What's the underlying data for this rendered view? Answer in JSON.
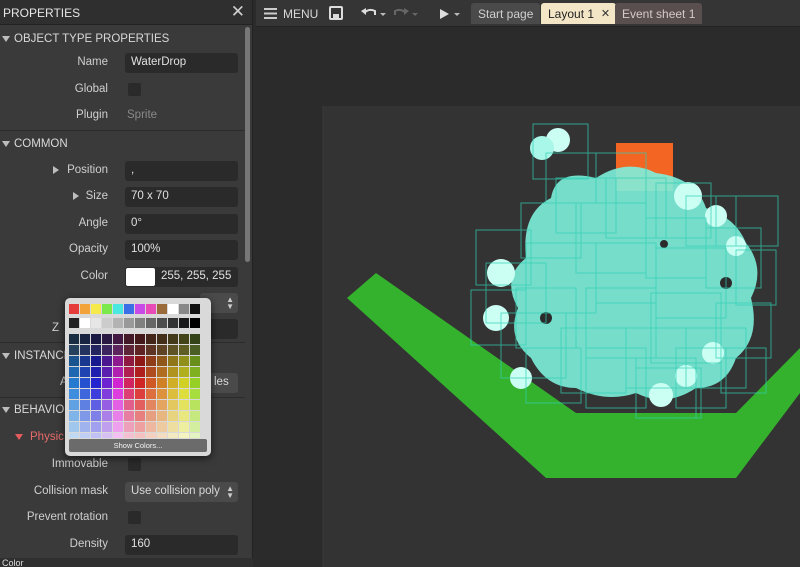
{
  "props": {
    "title": "PROPERTIES",
    "close": "✕",
    "sections": {
      "object_type": "OBJECT TYPE PROPERTIES",
      "common": "COMMON",
      "instance": "INSTANCE",
      "behaviors": "BEHAVIOR"
    },
    "rows": {
      "name_label": "Name",
      "name_value": "WaterDrop",
      "global_label": "Global",
      "plugin_label": "Plugin",
      "plugin_value": "Sprite",
      "position_label": "Position",
      "position_value": ",",
      "size_label": "Size",
      "size_value": "70 x 70",
      "angle_label": "Angle",
      "angle_value": "0°",
      "opacity_label": "Opacity",
      "opacity_value": "100%",
      "color_label": "Color",
      "color_value": "255, 255, 255",
      "z_label": "Z",
      "instance_partial_label": "A",
      "instance_partial_value": "les",
      "physics_label": "Physic",
      "immovable_label": "Immovable",
      "collision_label": "Collision mask",
      "collision_value": "Use collision poly",
      "prevent_rotation_label": "Prevent rotation",
      "density_label": "Density",
      "density_value": "160"
    },
    "bottom_text": "Color"
  },
  "picker": {
    "show_colors": "Show Colors..."
  },
  "topbar": {
    "menu": "MENU",
    "tabs": [
      "Start page",
      "Layout 1",
      "Event sheet 1"
    ],
    "tab_close": "✕"
  },
  "colors": {
    "accent_tab": "#f3e6c6",
    "ground": "#35b22d",
    "water": "#7df0dc",
    "orange": "#f26522"
  }
}
